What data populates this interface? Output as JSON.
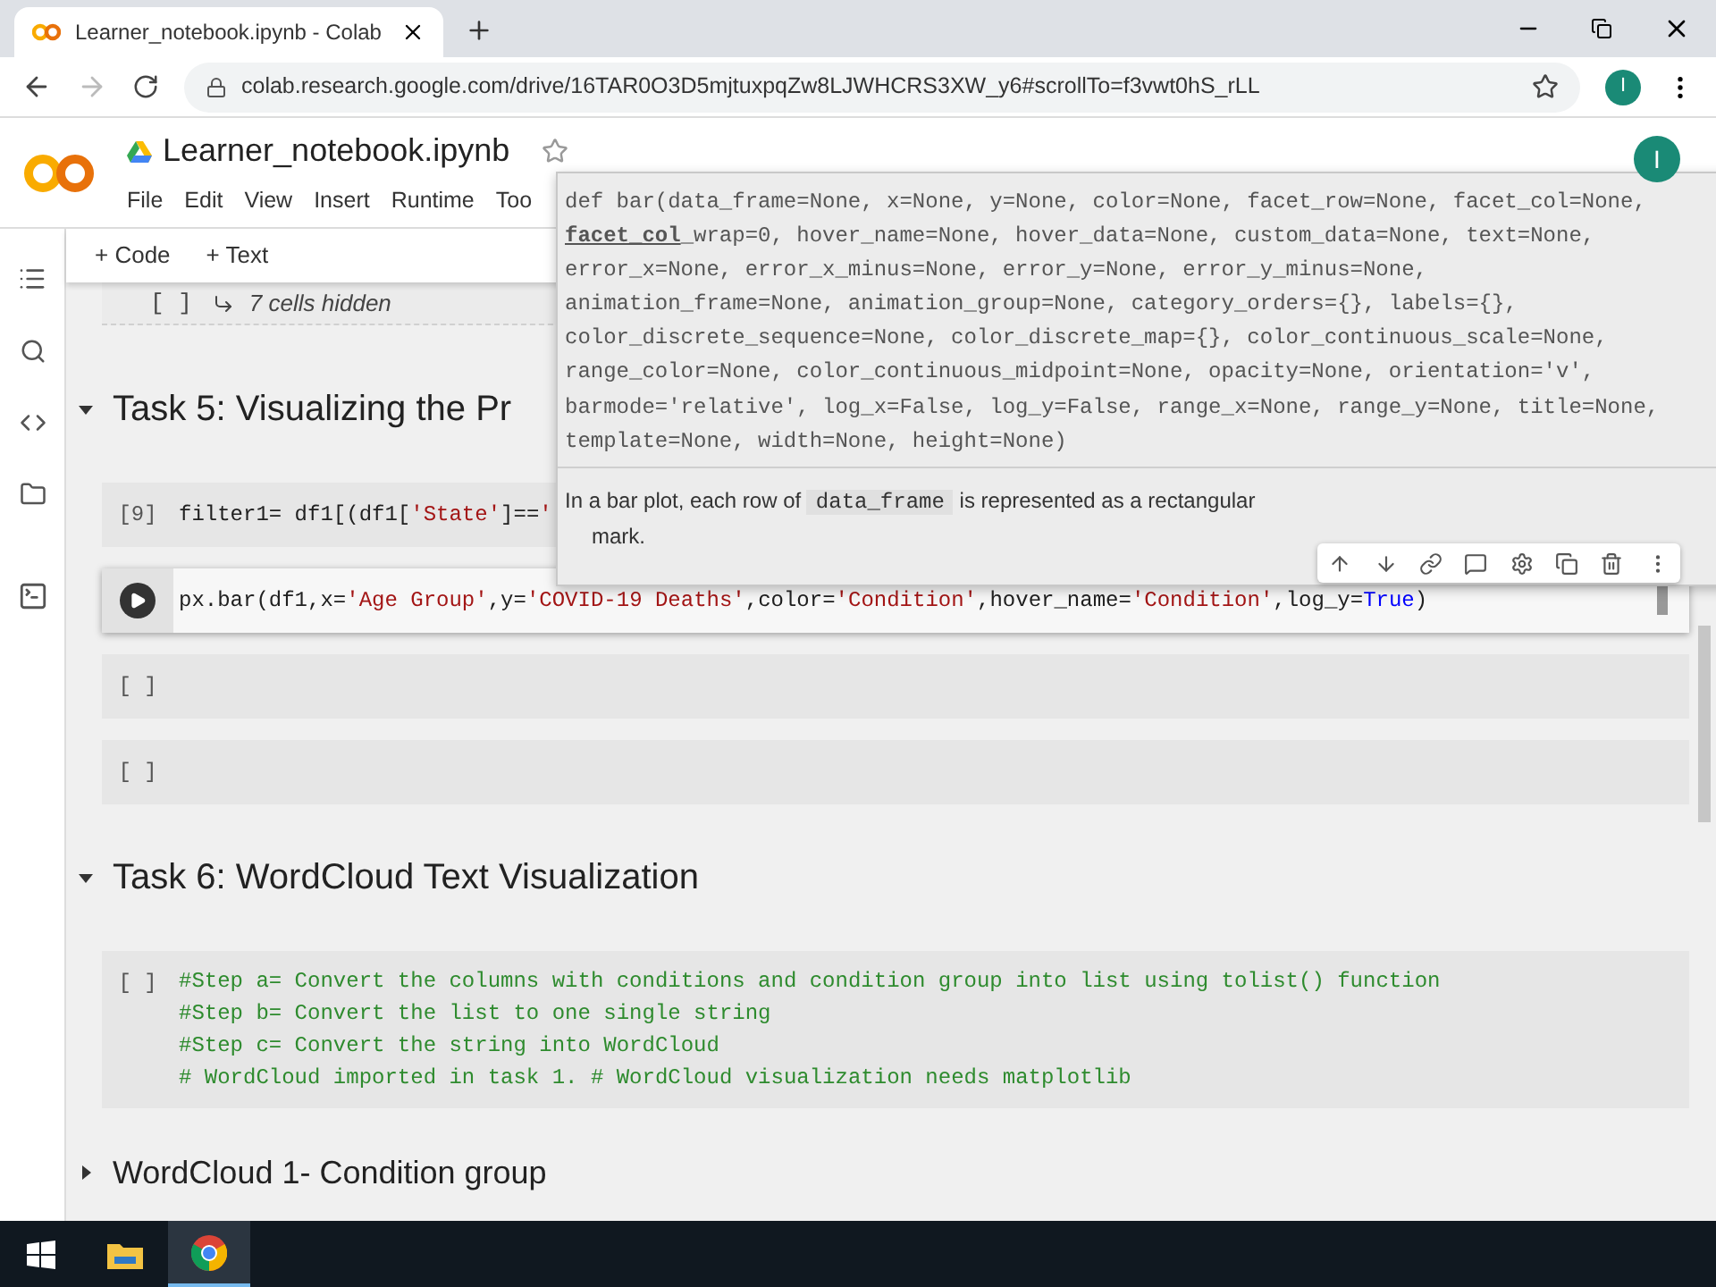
{
  "browser": {
    "tab_title": "Learner_notebook.ipynb - Colab",
    "url": "colab.research.google.com/drive/16TAR0O3D5mjtuxpqZw8LJWHCRS3XW_y6#scrollTo=f3vwt0hS_rLL",
    "avatar": "I"
  },
  "header": {
    "filename": "Learner_notebook.ipynb",
    "menu": [
      "File",
      "Edit",
      "View",
      "Insert",
      "Runtime",
      "Too"
    ],
    "avatar": "I"
  },
  "toolbar": [
    "+ Code",
    "+ Text"
  ],
  "cells": [
    {
      "kind": "hidden",
      "prompt": "[ ]",
      "text": "7 cells hidden"
    },
    {
      "kind": "heading",
      "title": "Task 5: Visualizing the Pr",
      "expanded": true
    },
    {
      "kind": "code",
      "prompt": "[9]",
      "active": false,
      "lines": [
        [
          {
            "t": "filter1= df1[(df1[",
            "kind": "plain"
          },
          {
            "t": "'State'",
            "kind": "string"
          },
          {
            "t": "]==",
            "kind": "plain"
          },
          {
            "t": "'",
            "kind": "string"
          }
        ]
      ]
    },
    {
      "kind": "code",
      "active": true,
      "lines": [
        [
          {
            "t": "px.bar(df1,x=",
            "kind": "plain"
          },
          {
            "t": "'Age Group'",
            "kind": "string"
          },
          {
            "t": ",y=",
            "kind": "plain"
          },
          {
            "t": "'COVID-19 Deaths'",
            "kind": "string"
          },
          {
            "t": ",color=",
            "kind": "plain"
          },
          {
            "t": "'Condition'",
            "kind": "string"
          },
          {
            "t": ",hover_name=",
            "kind": "plain"
          },
          {
            "t": "'Condition'",
            "kind": "string"
          },
          {
            "t": ",log_y=",
            "kind": "plain"
          },
          {
            "t": "True",
            "kind": "keyword"
          },
          {
            "t": ")",
            "kind": "plain"
          }
        ]
      ]
    },
    {
      "kind": "code",
      "prompt": "[ ]",
      "active": false
    },
    {
      "kind": "code",
      "prompt": "[ ]",
      "active": false
    },
    {
      "kind": "heading",
      "title": "Task 6: WordCloud Text Visualization",
      "expanded": true
    },
    {
      "kind": "code",
      "prompt": "[ ]",
      "active": false,
      "lines": [
        [
          {
            "t": "#Step a= Convert the columns with conditions and condition group into list using tolist() function",
            "kind": "comment"
          }
        ],
        [
          {
            "t": "#Step b= Convert the list to one single string",
            "kind": "comment"
          }
        ],
        [
          {
            "t": "#Step c= Convert the string into WordCloud",
            "kind": "comment"
          }
        ],
        [
          {
            "t": "# WordCloud imported in task 1. # WordCloud visualization needs matplotlib",
            "kind": "comment"
          }
        ]
      ]
    },
    {
      "kind": "heading",
      "title": "WordCloud 1- Condition group",
      "expanded": false
    }
  ],
  "tooltip": {
    "signature": [
      [
        {
          "t": "def bar(data_frame=None, x=None, y=None, color=None, facet_row=None, facet_col=None,",
          "underlined": false
        }
      ],
      [
        {
          "t": "facet_col",
          "underlined": true
        },
        {
          "t": "_wrap=0, hover_name=None, hover_data=None, custom_data=None, text=None,",
          "underlined": false
        }
      ],
      [
        {
          "t": "error_x=None, error_x_minus=None, error_y=None, error_y_minus=None,",
          "underlined": false
        }
      ],
      [
        {
          "t": "animation_frame=None, animation_group=None, category_orders={}, labels={},",
          "underlined": false
        }
      ],
      [
        {
          "t": "color_discrete_sequence=None, color_discrete_map={}, color_continuous_scale=None,",
          "underlined": false
        }
      ],
      [
        {
          "t": "range_color=None, color_continuous_midpoint=None, opacity=None, orientation='v',",
          "underlined": false
        }
      ],
      [
        {
          "t": "barmode='relative', log_x=False, log_y=False, range_x=None, range_y=None, title=None,",
          "underlined": false
        }
      ],
      [
        {
          "t": "template=None, width=None, height=None)",
          "underlined": false
        }
      ]
    ],
    "description": [
      {
        "t": "In a bar plot, each row of ",
        "kind": "plain"
      },
      {
        "t": "data_frame",
        "kind": "code"
      },
      {
        "t": " is represented as a rectangular mark.",
        "kind": "plain"
      }
    ]
  }
}
